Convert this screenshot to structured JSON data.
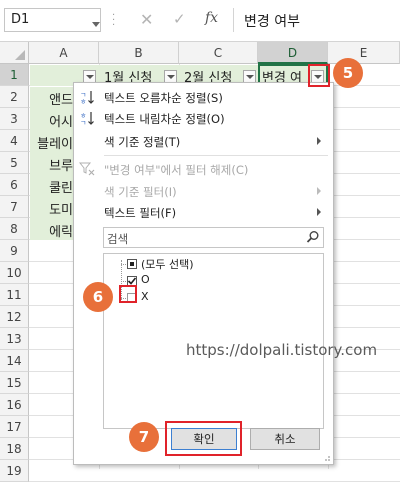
{
  "formula_bar": {
    "name_box": "D1",
    "fx_label": "fx",
    "formula": "변경 여부",
    "cancel_glyph": "✕",
    "confirm_glyph": "✓"
  },
  "columns": [
    "A",
    "B",
    "C",
    "D",
    "E"
  ],
  "rows": [
    "1",
    "2",
    "3",
    "4",
    "5",
    "6",
    "7",
    "8",
    "9",
    "10",
    "11",
    "12",
    "13",
    "14",
    "15",
    "16",
    "17",
    "18",
    "19"
  ],
  "header_cells": {
    "b1": "1월 신청",
    "c1": "2월 신청",
    "d1": "변경 여"
  },
  "column_a_values": [
    "앤드",
    "어시",
    "블레이",
    "브루",
    "쿨린",
    "도미",
    "에릭"
  ],
  "dropdown": {
    "sort_asc": "텍스트 오름차순 정렬(S)",
    "sort_desc": "텍스트 내림차순 정렬(O)",
    "sort_color": "색 기준 정렬(T)",
    "clear_filter": "\"변경 여부\"에서 필터 해제(C)",
    "filter_color": "색 기준 필터(I)",
    "text_filter": "텍스트 필터(F)",
    "search_placeholder": "검색",
    "items": [
      {
        "label": "(모두 선택)",
        "state": "partial"
      },
      {
        "label": "O",
        "state": "checked"
      },
      {
        "label": "X",
        "state": "unchecked"
      }
    ],
    "ok_label": "확인",
    "cancel_label": "취소"
  },
  "annotations": {
    "step5": "5",
    "step6": "6",
    "step7": "7",
    "accent_color": "#e8703a",
    "highlight_color": "#e0232a"
  },
  "watermark": "https://dolpali.tistory.com"
}
